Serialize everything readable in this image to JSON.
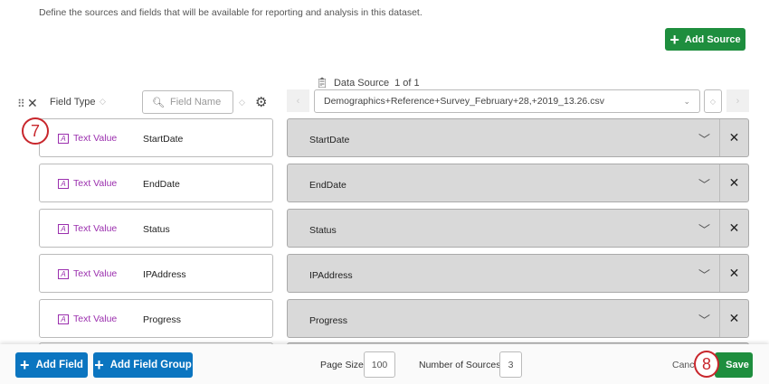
{
  "description": "Define the sources and fields that will be available for reporting and analysis in this dataset.",
  "add_source": "Add Source",
  "header": {
    "field_type": "Field Type",
    "field_name_placeholder": "Field Name",
    "data_source_label": "Data Source",
    "data_source_index": "1 of 1",
    "source_file": "Demographics+Reference+Survey_February+28,+2019_13.26.csv"
  },
  "rows": [
    {
      "type": "Text Value",
      "name": "StartDate",
      "mapped": "StartDate"
    },
    {
      "type": "Text Value",
      "name": "EndDate",
      "mapped": "EndDate"
    },
    {
      "type": "Text Value",
      "name": "Status",
      "mapped": "Status"
    },
    {
      "type": "Text Value",
      "name": "IPAddress",
      "mapped": "IPAddress"
    },
    {
      "type": "Text Value",
      "name": "Progress",
      "mapped": "Progress"
    }
  ],
  "annotations": {
    "step7": "7",
    "step8": "8"
  },
  "footer": {
    "add_field": "Add Field",
    "add_field_group": "Add Field Group",
    "page_size_label": "Page Size:",
    "page_size": "100",
    "num_sources_label": "Number of Sources:",
    "num_sources": "3",
    "cancel": "Cancel",
    "save": "Save"
  }
}
